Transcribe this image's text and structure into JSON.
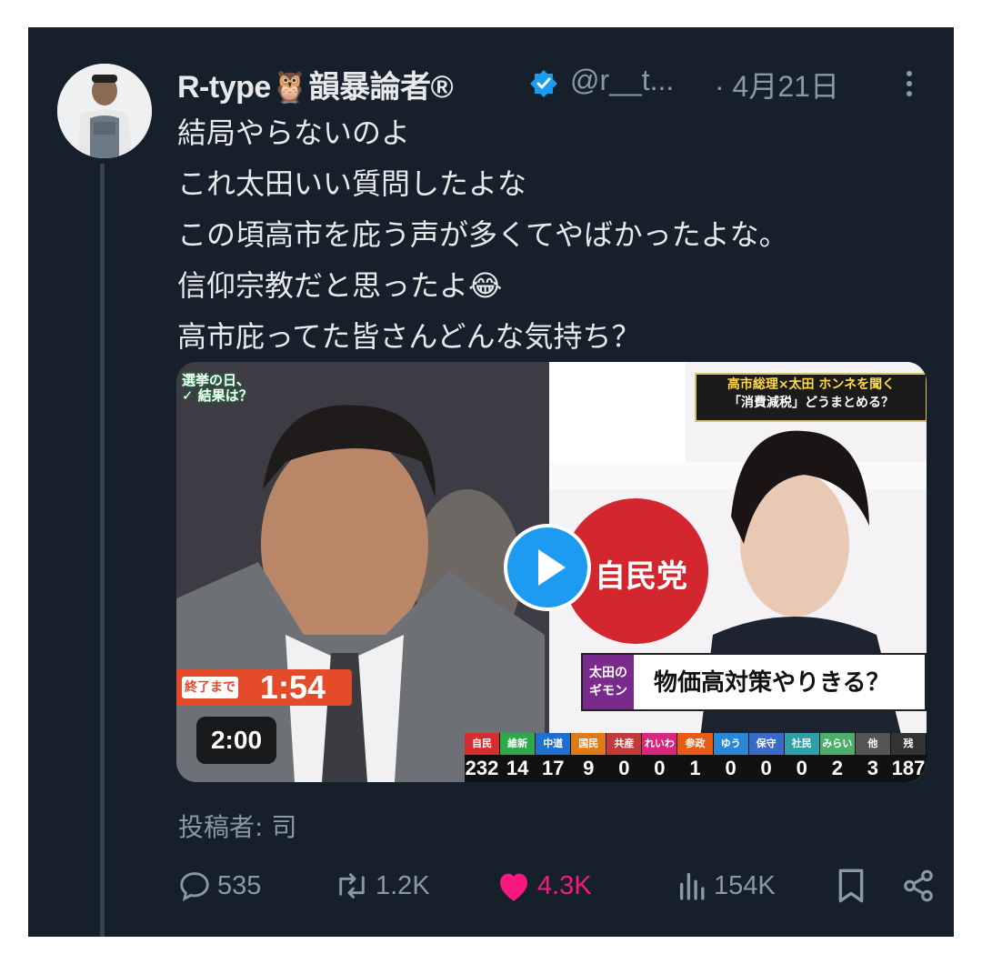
{
  "tweet": {
    "display_name": "R-type🦉韻暴論者®",
    "handle": "@r__t...",
    "date": "· 4月21日",
    "lines": [
      "結局やらないのよ",
      "これ太田いい質問したよな",
      "この頃高市を庇う声が多くてやばかったよな。",
      "信仰宗教だと思ったよ😂",
      "高市庇ってた皆さんどんな気持ち？"
    ],
    "posted_by": "投稿者: 司"
  },
  "media": {
    "corner_tag": [
      "選挙の日、",
      "✓ 結果は？"
    ],
    "headline": [
      "高市総理×太田 ホンネを聞く",
      "「消費減税」どうまとめる？"
    ],
    "timer_label": "終了まで",
    "timer_value": "1:54",
    "gimon_badge": [
      "太田の",
      "ギモン"
    ],
    "gimon_question": "物価高対策やりきる？",
    "party_logo": "自民党",
    "duration": "2:00",
    "seats": [
      {
        "party": "自民",
        "count": "232",
        "color": "#d62d2d"
      },
      {
        "party": "維新",
        "count": "14",
        "color": "#2ea84a"
      },
      {
        "party": "中道",
        "count": "17",
        "color": "#1f6fd1"
      },
      {
        "party": "国民",
        "count": "9",
        "color": "#e07a16"
      },
      {
        "party": "共産",
        "count": "0",
        "color": "#c23a3a"
      },
      {
        "party": "れいわ",
        "count": "0",
        "color": "#d8257e"
      },
      {
        "party": "参政",
        "count": "1",
        "color": "#e85b12"
      },
      {
        "party": "ゆう",
        "count": "0",
        "color": "#2a86d8"
      },
      {
        "party": "保守",
        "count": "0",
        "color": "#3a6ac8"
      },
      {
        "party": "社民",
        "count": "0",
        "color": "#2ca0a6"
      },
      {
        "party": "みらい",
        "count": "2",
        "color": "#4cae6a"
      },
      {
        "party": "他",
        "count": "3",
        "color": "#555555"
      },
      {
        "party": "残",
        "count": "187",
        "color": "#333333"
      }
    ]
  },
  "actions": {
    "replies": "535",
    "reposts": "1.2K",
    "likes": "4.3K",
    "views": "154K"
  }
}
